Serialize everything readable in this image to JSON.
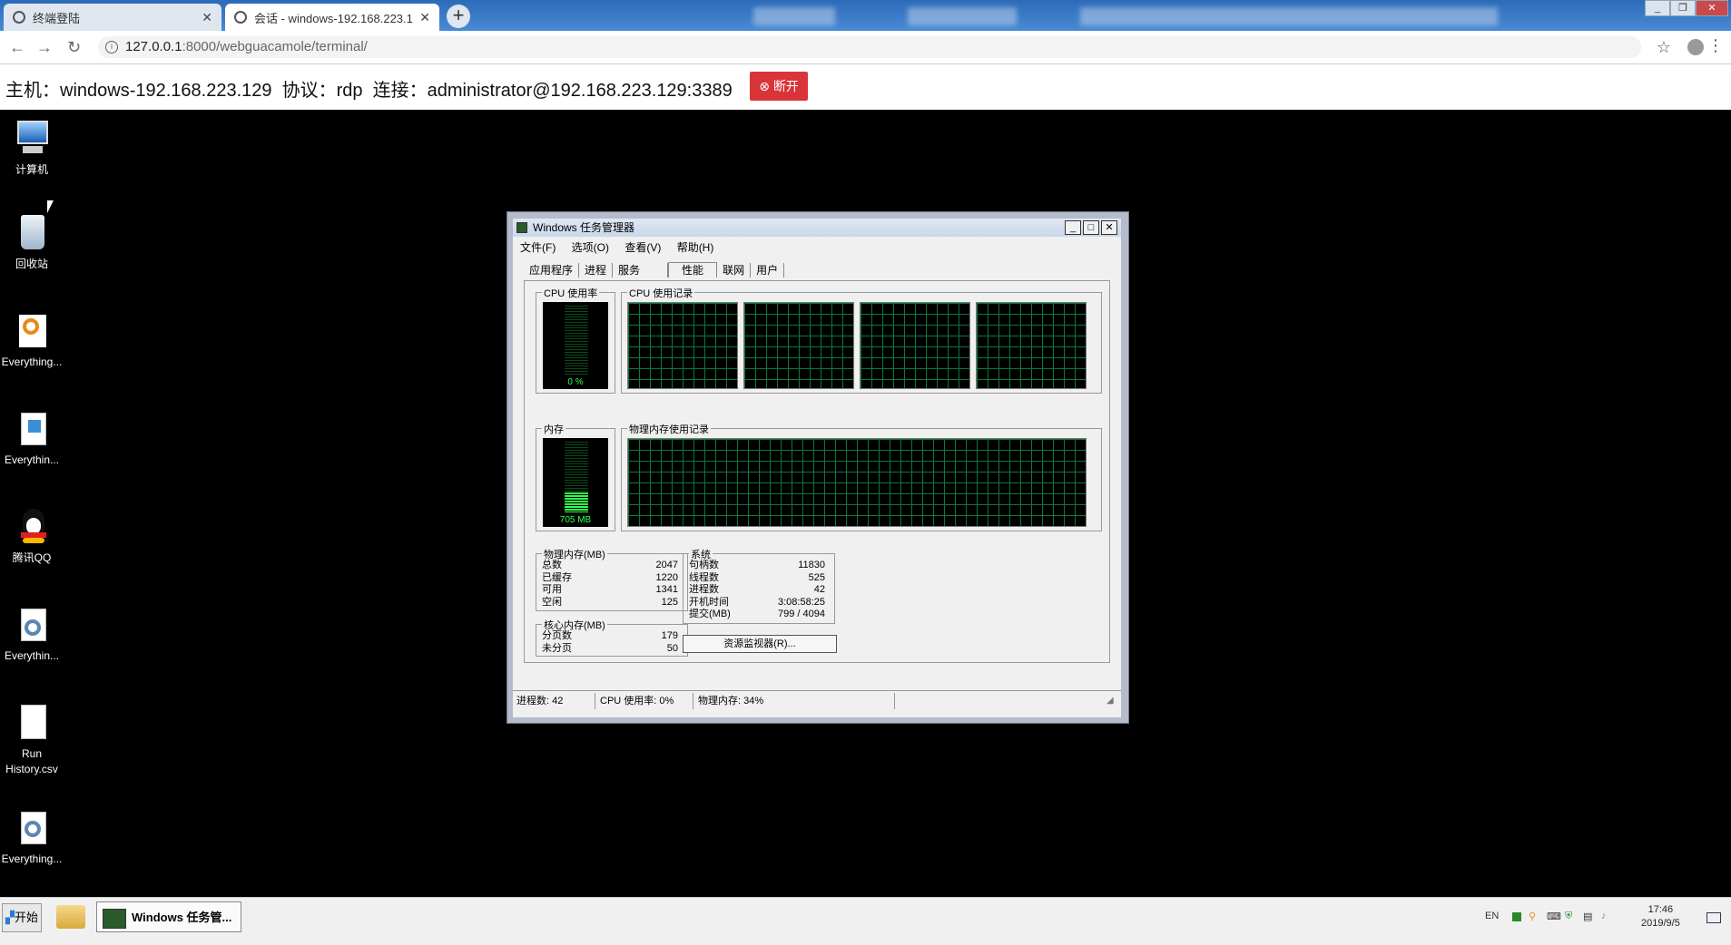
{
  "browser": {
    "tabs": [
      {
        "title": "终端登陆"
      },
      {
        "title": "会话 - windows-192.168.223.1..."
      }
    ],
    "url_host": "127.0.0.1",
    "url_rest": ":8000/webguacamole/terminal/",
    "new_tab": "+"
  },
  "session_bar": {
    "info": "主机：windows-192.168.223.129  协议：rdp  连接：administrator@192.168.223.129:3389",
    "disconnect_label": "断开",
    "disconnect_color": "#d9343a"
  },
  "desktop": {
    "icons": [
      {
        "label": "计算机",
        "icon": "computer-icon"
      },
      {
        "label": "回收站",
        "icon": "recycle-bin-icon"
      },
      {
        "label": "Everything...",
        "icon": "magnifier-icon"
      },
      {
        "label": "Everythin...",
        "icon": "document-icon"
      },
      {
        "label": "腾讯QQ",
        "icon": "qq-penguin-icon"
      },
      {
        "label": "Everythin...",
        "icon": "gear-document-icon"
      },
      {
        "label": "Run History.csv",
        "icon": "file-icon"
      },
      {
        "label": "Everything...",
        "icon": "gear-document-icon"
      }
    ]
  },
  "task_manager": {
    "title": "Windows 任务管理器",
    "menu": [
      "文件(F)",
      "选项(O)",
      "查看(V)",
      "帮助(H)"
    ],
    "tabs": [
      "应用程序",
      "进程",
      "服务",
      "性能",
      "联网",
      "用户"
    ],
    "selected_tab": "性能",
    "cpu_usage_label": "CPU 使用率",
    "cpu_usage_value": "0 %",
    "cpu_history_label": "CPU 使用记录",
    "memory_label": "内存",
    "memory_value": "705 MB",
    "memory_fraction": 0.34,
    "mem_history_label": "物理内存使用记录",
    "physical_memory": {
      "title": "物理内存(MB)",
      "rows": [
        [
          "总数",
          "2047"
        ],
        [
          "已缓存",
          "1220"
        ],
        [
          "可用",
          "1341"
        ],
        [
          "空闲",
          "125"
        ]
      ]
    },
    "kernel_memory": {
      "title": "核心内存(MB)",
      "rows": [
        [
          "分页数",
          "179"
        ],
        [
          "未分页",
          "50"
        ]
      ]
    },
    "system": {
      "title": "系统",
      "rows": [
        [
          "句柄数",
          "11830"
        ],
        [
          "线程数",
          "525"
        ],
        [
          "进程数",
          "42"
        ],
        [
          "开机时间",
          "3:08:58:25"
        ],
        [
          "提交(MB)",
          "799 / 4094"
        ]
      ]
    },
    "resource_monitor_button": "资源监视器(R)...",
    "status": {
      "processes": "进程数: 42",
      "cpu": "CPU 使用率: 0%",
      "memory": "物理内存: 34%"
    }
  },
  "taskbar": {
    "start": "开始",
    "active_item": "Windows 任务管...",
    "lang": "EN",
    "time": "17:46",
    "date": "2019/9/5"
  }
}
